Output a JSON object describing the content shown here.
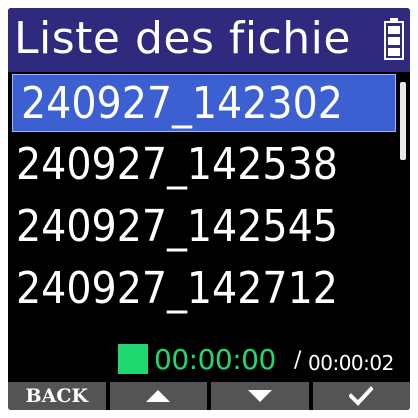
{
  "header": {
    "title": "Liste des fichie",
    "battery_icon": "battery-icon"
  },
  "files": [
    {
      "name": "240927_142302",
      "selected": true
    },
    {
      "name": "240927_142538",
      "selected": false
    },
    {
      "name": "240927_142545",
      "selected": false
    },
    {
      "name": "240927_142712",
      "selected": false
    }
  ],
  "status": {
    "indicator_icon": "stop-square-icon",
    "current_time": "00:00:00",
    "separator": "/",
    "total_time": "00:00:02"
  },
  "softkeys": {
    "back_label": "BACK",
    "up_icon": "arrow-up-icon",
    "down_icon": "arrow-down-icon",
    "ok_icon": "checkmark-icon"
  },
  "colors": {
    "header_bg": "#2f2a7e",
    "selection_bg": "#3c5fd1",
    "accent_green": "#1fd86f",
    "softkey_bg": "#545454"
  }
}
